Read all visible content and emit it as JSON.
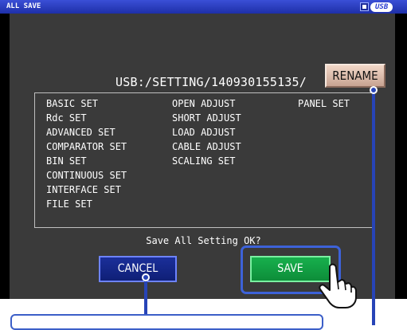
{
  "titlebar": {
    "title": "ALL SAVE",
    "usb_icon": "usb-drive-icon",
    "usb_label": "USB"
  },
  "path": "USB:/SETTING/140930155135/",
  "buttons": {
    "rename": "RENAME",
    "cancel": "CANCEL",
    "save": "SAVE"
  },
  "settings_list": {
    "col1": [
      "BASIC SET",
      "Rdc SET",
      "ADVANCED SET",
      "COMPARATOR SET",
      "BIN SET",
      "CONTINUOUS SET",
      "INTERFACE SET",
      "FILE SET"
    ],
    "col2": [
      "OPEN ADJUST",
      "SHORT ADJUST",
      "LOAD ADJUST",
      "CABLE ADJUST",
      "SCALING SET"
    ],
    "col3": [
      "PANEL SET"
    ]
  },
  "confirm_text": "Save All Setting OK?",
  "colors": {
    "title_bar": "#2436c0",
    "panel_bg": "#3a3a3a",
    "cancel_btn": "#14268a",
    "save_btn": "#14a846",
    "rename_btn": "#e5c6b6",
    "callout": "#2744b7"
  },
  "icons": {
    "pointer": "hand-pointer-icon"
  }
}
